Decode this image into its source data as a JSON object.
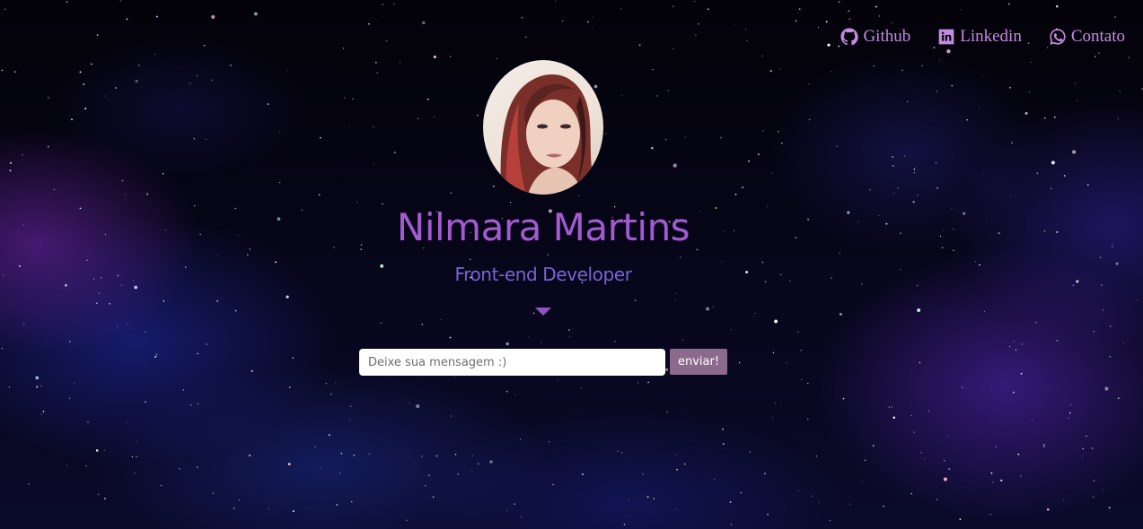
{
  "nav": {
    "links": [
      {
        "label": "Github",
        "icon": "github-icon"
      },
      {
        "label": "Linkedin",
        "icon": "linkedin-icon"
      },
      {
        "label": "Contato",
        "icon": "whatsapp-icon"
      }
    ]
  },
  "hero": {
    "name": "Nilmara Martins",
    "role": "Front-end Developer"
  },
  "message_form": {
    "placeholder": "Deixe sua mensagem :)",
    "value": "",
    "submit_label": "enviar!"
  },
  "colors": {
    "accent": "#a45ad1",
    "nav_text": "#c48be0",
    "role_text": "#7a62d8",
    "button_bg": "#8c6a8e",
    "background": "#05040f"
  }
}
